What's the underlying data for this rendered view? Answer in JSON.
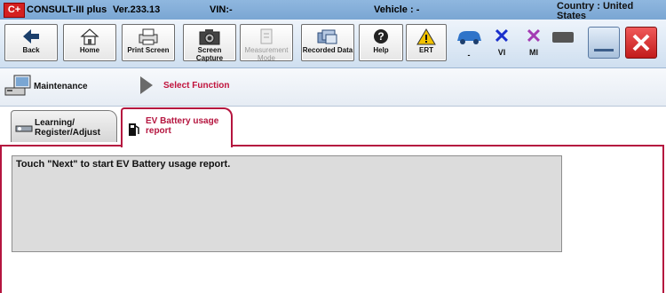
{
  "title_bar": {
    "logo": "C+",
    "app_name": "CONSULT-III plus",
    "version": "Ver.233.13",
    "vin": "VIN:-",
    "vehicle": "Vehicle : -",
    "country": "Country : United States"
  },
  "toolbar": {
    "back": "Back",
    "home": "Home",
    "print_screen": "Print Screen",
    "screen_capture": "Screen Capture",
    "measurement_mode": "Measurement Mode",
    "recorded_data": "Recorded Data",
    "help": "Help",
    "ert": "ERT",
    "status_vehicle": "-",
    "status_vi": "VI",
    "status_mi": "MI"
  },
  "nav": {
    "maintenance": "Maintenance",
    "select_function": "Select Function"
  },
  "tabs": [
    {
      "label": "Learning/ Register/Adjust"
    },
    {
      "label": "EV Battery usage report"
    }
  ],
  "content": {
    "message": "Touch \"Next\" to start EV Battery usage report."
  },
  "colors": {
    "accent": "#b5153f",
    "vi_x": "#1a2fcc",
    "mi_x": "#a33bb3",
    "close_red": "#d82a2a"
  }
}
